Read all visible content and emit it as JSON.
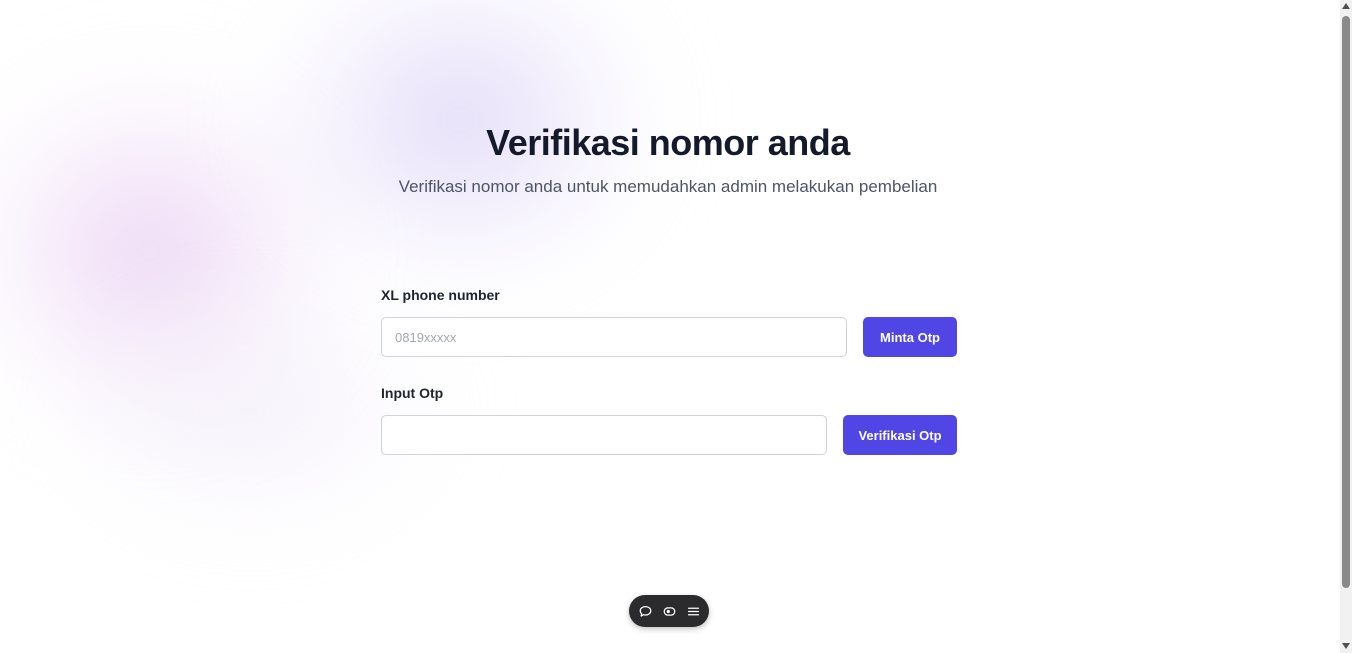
{
  "header": {
    "title": "Verifikasi nomor anda",
    "subtitle": "Verifikasi nomor anda untuk memudahkan admin melakukan pembelian"
  },
  "form": {
    "phone": {
      "label": "XL phone number",
      "value": "",
      "placeholder": "0819xxxxx",
      "button_label": "Minta Otp"
    },
    "otp": {
      "label": "Input Otp",
      "value": "",
      "placeholder": "",
      "button_label": "Verifikasi Otp"
    }
  },
  "toolbar": {
    "icons": [
      "chat-icon",
      "eye-toggle-icon",
      "menu-icon"
    ]
  },
  "colors": {
    "accent": "#4f46e5",
    "title": "#141a2b",
    "subtitle": "#4b5566",
    "toolbar_bg": "#2b2b2d"
  }
}
